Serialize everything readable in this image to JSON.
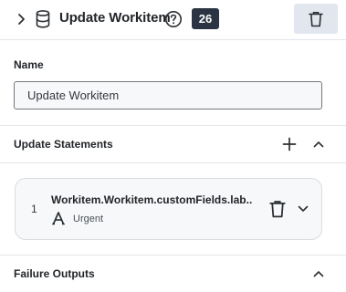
{
  "header": {
    "title": "Update Workitem",
    "badge": "26",
    "icons": {
      "expand": "chevron-right-icon",
      "node_type": "database-icon",
      "help": "help-circle-icon",
      "delete": "trash-icon"
    }
  },
  "name_section": {
    "label": "Name",
    "input_value": "Update Workitem"
  },
  "update_statements": {
    "title": "Update Statements",
    "icons": {
      "add": "plus-icon",
      "collapse": "chevron-up-icon"
    },
    "items": [
      {
        "index": "1",
        "path": "Workitem.Workitem.customFields.lab...",
        "value": "Urgent",
        "icons": {
          "type": "text-type-icon",
          "delete": "trash-icon",
          "expand": "chevron-down-icon"
        }
      }
    ]
  },
  "failure_outputs": {
    "title": "Failure Outputs",
    "icons": {
      "collapse": "chevron-up-icon"
    }
  },
  "colors": {
    "badge_bg": "#2b3442",
    "delete_button_bg": "#e2e6ee",
    "divider": "#e4e6ea",
    "card_bg": "#f7f8fa",
    "text": "#222529"
  }
}
